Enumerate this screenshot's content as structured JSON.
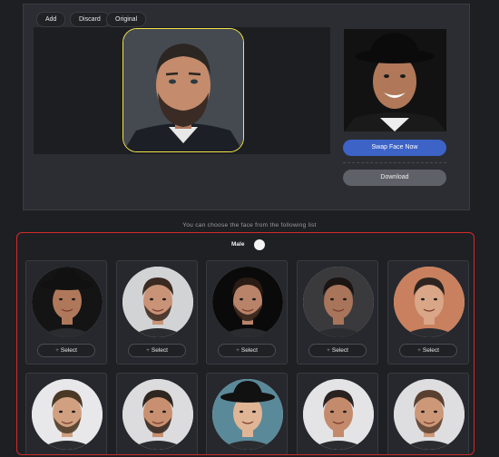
{
  "toolbar": {
    "add_label": "Add",
    "discard_label": "Discard",
    "original_label": "Original"
  },
  "actions": {
    "swap_label": "Swap Face Now",
    "download_label": "Download"
  },
  "colors": {
    "accent": "#3d63c7",
    "highlight_border": "#f3e54a",
    "list_border": "#d32a2a"
  },
  "face_list": {
    "hint": "You can choose the face from the following list",
    "gender_label": "Male",
    "select_label": "Select",
    "faces": [
      {
        "bg": "#141414",
        "skin": "#b0785a",
        "hair": "#0e0e0e",
        "hat": true,
        "beard": false
      },
      {
        "bg": "#d2d3d5",
        "skin": "#c99378",
        "hair": "#3a2a20",
        "hat": false,
        "beard": true
      },
      {
        "bg": "#0a0a0a",
        "skin": "#b9836a",
        "hair": "#2a1c14",
        "hat": false,
        "beard": true
      },
      {
        "bg": "#3a3a3c",
        "skin": "#a8745a",
        "hair": "#1a1412",
        "hat": false,
        "beard": false
      },
      {
        "bg": "#c9805e",
        "skin": "#d9a688",
        "hair": "#2d2420",
        "hat": false,
        "beard": false
      },
      {
        "bg": "#e8e8ea",
        "skin": "#d0a080",
        "hair": "#4a3826",
        "hat": false,
        "beard": true
      },
      {
        "bg": "#dcdcde",
        "skin": "#c89070",
        "hair": "#2e2620",
        "hat": false,
        "beard": true
      },
      {
        "bg": "#5a8a9a",
        "skin": "#e0b596",
        "hair": "#a07850",
        "hat": true,
        "beard": false
      },
      {
        "bg": "#e4e4e6",
        "skin": "#c48a6c",
        "hair": "#2a2220",
        "hat": false,
        "beard": false
      },
      {
        "bg": "#dedee0",
        "skin": "#cc9878",
        "hair": "#5a4030",
        "hat": false,
        "beard": true
      }
    ]
  }
}
